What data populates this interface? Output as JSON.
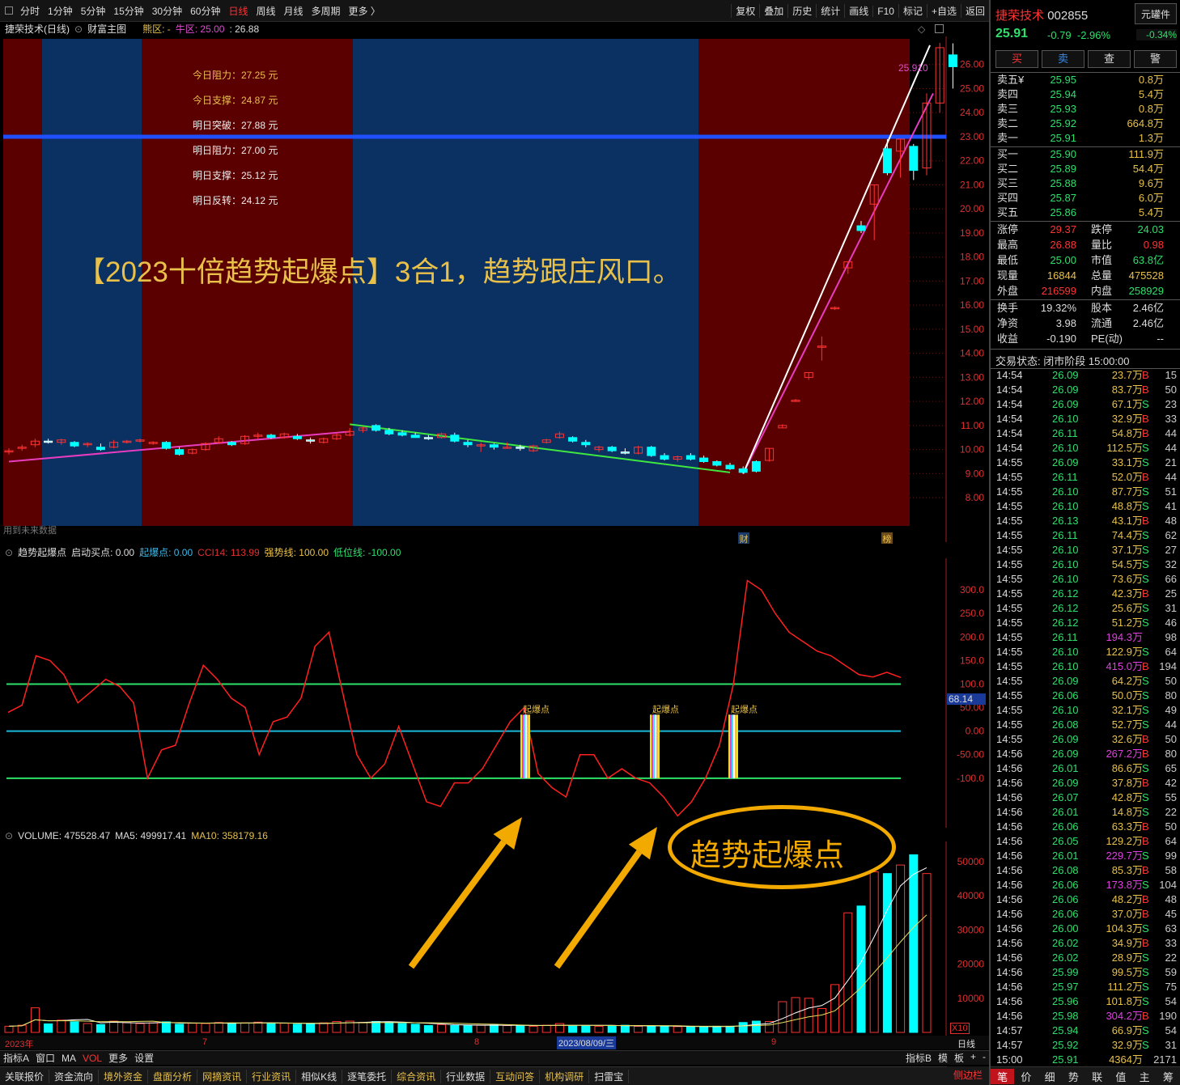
{
  "toolbar": {
    "periods": [
      "分时",
      "1分钟",
      "5分钟",
      "15分钟",
      "30分钟",
      "60分钟",
      "日线",
      "周线",
      "月线",
      "多周期",
      "更多 〉"
    ],
    "active": "日线",
    "right": [
      "复权",
      "叠加",
      "历史",
      "统计",
      "画线",
      "F10",
      "标记",
      "+自选",
      "返回"
    ]
  },
  "header": {
    "stock": "捷荣技术(日线)",
    "indicator": "财富主图",
    "can_label": "熊区: -",
    "bull_label": "牛区: 25.00",
    "value": ": 26.88"
  },
  "levels": [
    "今日阻力：27.25 元",
    "今日支撑：24.87 元",
    "明日突破：27.88 元",
    "明日阻力：27.00 元",
    "明日支撑：25.12 元",
    "明日反转：24.12 元"
  ],
  "headline": "【2023十倍趋势起爆点】3合1，趋势跟庄风口。",
  "future_note": "用到未来数据",
  "last_price_tag": "25.910",
  "markers": {
    "cai": "财",
    "bang": "榜"
  },
  "main_axis": [
    "26.00",
    "25.00",
    "24.00",
    "23.00",
    "22.00",
    "21.00",
    "20.00",
    "19.00",
    "18.00",
    "17.00",
    "16.00",
    "15.00",
    "14.00",
    "13.00",
    "12.00",
    "11.00",
    "10.00",
    "9.00",
    "8.00"
  ],
  "ind_header": {
    "name": "趋势起爆点",
    "start": "启动买点: 0.00",
    "qbd": "起爆点: 0.00",
    "cci": "CCI14: 113.99",
    "strong": "强势线: 100.00",
    "low": "低位线: -100.00"
  },
  "ind_axis": [
    "300.0",
    "250.0",
    "200.0",
    "150.0",
    "100.0",
    "50.00",
    "0.00",
    "-50.00",
    "-100.0"
  ],
  "ind_tag": "68.14",
  "qbd_label": "起爆点",
  "vol_header": {
    "vol": "VOLUME: 475528.47",
    "ma5": "MA5: 499917.41",
    "ma10": "MA10: 358179.16"
  },
  "vol_axis": [
    "50000",
    "40000",
    "30000",
    "20000",
    "10000"
  ],
  "vol_unit": "X10",
  "oval_text": "趋势起爆点",
  "date_axis": {
    "year": "2023年",
    "m7": "7",
    "m8": "8",
    "m9": "9",
    "cursor": "2023/08/09/三",
    "period": "日线"
  },
  "tabs1": [
    "指标A",
    "窗口",
    "MA",
    "VOL",
    "更多",
    "设置"
  ],
  "tabs1_active": "VOL",
  "tabs1_right": [
    "指标B",
    "模",
    "板",
    "+",
    "-"
  ],
  "tabs2": [
    "关联报价",
    "资金流向",
    "境外资金",
    "盘面分析",
    "网摘资讯",
    "行业资讯",
    "相似K线",
    "逐笔委托",
    "综合资讯",
    "行业数据",
    "互动问答",
    "机构调研",
    "扫雷宝"
  ],
  "tabs2_right": "侧边栏",
  "side": {
    "name": "捷荣技术",
    "code": "002855",
    "unit": "元罐件",
    "price": "25.91",
    "chg": "-0.79",
    "pct": "-2.96%",
    "pct_box": "-0.34%",
    "btns": [
      "买",
      "卖",
      "查",
      "警"
    ],
    "asks": [
      [
        "卖五¥",
        "25.95",
        "0.8万"
      ],
      [
        "卖四",
        "25.94",
        "5.4万"
      ],
      [
        "卖三",
        "25.93",
        "0.8万"
      ],
      [
        "卖二",
        "25.92",
        "664.8万"
      ],
      [
        "卖一",
        "25.91",
        "1.3万"
      ]
    ],
    "bids": [
      [
        "买一",
        "25.90",
        "111.9万"
      ],
      [
        "买二",
        "25.89",
        "54.4万"
      ],
      [
        "买三",
        "25.88",
        "9.6万"
      ],
      [
        "买四",
        "25.87",
        "6.0万"
      ],
      [
        "买五",
        "25.86",
        "5.4万"
      ]
    ],
    "stats": [
      [
        "涨停",
        "29.37",
        "跌停",
        "24.03"
      ],
      [
        "最高",
        "26.88",
        "量比",
        "0.98"
      ],
      [
        "最低",
        "25.00",
        "市值",
        "63.8亿"
      ],
      [
        "现量",
        "16844",
        "总量",
        "475528"
      ],
      [
        "外盘",
        "216599",
        "内盘",
        "258929"
      ]
    ],
    "stats2": [
      [
        "换手",
        "19.32%",
        "股本",
        "2.46亿"
      ],
      [
        "净资",
        "3.98",
        "流通",
        "2.46亿"
      ],
      [
        "收益",
        "-0.190",
        "PE(动)",
        "--"
      ]
    ],
    "status": "交易状态: 闭市阶段 15:00:00",
    "ticks": [
      [
        "14:54",
        "26.09",
        "23.7万",
        "B",
        "15"
      ],
      [
        "14:54",
        "26.09",
        "83.7万",
        "B",
        "50"
      ],
      [
        "14:54",
        "26.09",
        "67.1万",
        "S",
        "23"
      ],
      [
        "14:54",
        "26.10",
        "32.9万",
        "B",
        "33"
      ],
      [
        "14:54",
        "26.11",
        "54.8万",
        "B",
        "44"
      ],
      [
        "14:54",
        "26.10",
        "112.5万",
        "S",
        "44"
      ],
      [
        "14:55",
        "26.09",
        "33.1万",
        "S",
        "21"
      ],
      [
        "14:55",
        "26.11",
        "52.0万",
        "B",
        "44"
      ],
      [
        "14:55",
        "26.10",
        "87.7万",
        "S",
        "51"
      ],
      [
        "14:55",
        "26.10",
        "48.8万",
        "S",
        "41"
      ],
      [
        "14:55",
        "26.13",
        "43.1万",
        "B",
        "48"
      ],
      [
        "14:55",
        "26.11",
        "74.4万",
        "S",
        "62"
      ],
      [
        "14:55",
        "26.10",
        "37.1万",
        "S",
        "27"
      ],
      [
        "14:55",
        "26.10",
        "54.5万",
        "S",
        "32"
      ],
      [
        "14:55",
        "26.10",
        "73.6万",
        "S",
        "66"
      ],
      [
        "14:55",
        "26.12",
        "42.3万",
        "B",
        "25"
      ],
      [
        "14:55",
        "26.12",
        "25.6万",
        "S",
        "31"
      ],
      [
        "14:55",
        "26.12",
        "51.2万",
        "S",
        "46"
      ],
      [
        "14:55",
        "26.11",
        "194.3万",
        "",
        "98"
      ],
      [
        "14:55",
        "26.10",
        "122.9万",
        "S",
        "64"
      ],
      [
        "14:55",
        "26.10",
        "415.0万",
        "B",
        "194"
      ],
      [
        "14:55",
        "26.09",
        "64.2万",
        "S",
        "50"
      ],
      [
        "14:55",
        "26.06",
        "50.0万",
        "S",
        "80"
      ],
      [
        "14:55",
        "26.10",
        "32.1万",
        "S",
        "49"
      ],
      [
        "14:55",
        "26.08",
        "52.7万",
        "S",
        "44"
      ],
      [
        "14:55",
        "26.09",
        "32.6万",
        "B",
        "50"
      ],
      [
        "14:56",
        "26.09",
        "267.2万",
        "B",
        "80"
      ],
      [
        "14:56",
        "26.01",
        "86.6万",
        "S",
        "65"
      ],
      [
        "14:56",
        "26.09",
        "37.8万",
        "B",
        "42"
      ],
      [
        "14:56",
        "26.07",
        "42.8万",
        "S",
        "55"
      ],
      [
        "14:56",
        "26.01",
        "14.8万",
        "S",
        "22"
      ],
      [
        "14:56",
        "26.06",
        "63.3万",
        "B",
        "50"
      ],
      [
        "14:56",
        "26.05",
        "129.2万",
        "B",
        "64"
      ],
      [
        "14:56",
        "26.01",
        "229.7万",
        "S",
        "99"
      ],
      [
        "14:56",
        "26.08",
        "85.3万",
        "B",
        "58"
      ],
      [
        "14:56",
        "26.06",
        "173.8万",
        "S",
        "104"
      ],
      [
        "14:56",
        "26.06",
        "48.2万",
        "B",
        "48"
      ],
      [
        "14:56",
        "26.06",
        "37.0万",
        "B",
        "45"
      ],
      [
        "14:56",
        "26.00",
        "104.3万",
        "S",
        "63"
      ],
      [
        "14:56",
        "26.02",
        "34.9万",
        "B",
        "33"
      ],
      [
        "14:56",
        "26.02",
        "28.9万",
        "S",
        "22"
      ],
      [
        "14:56",
        "25.99",
        "99.5万",
        "S",
        "59"
      ],
      [
        "14:56",
        "25.97",
        "111.2万",
        "S",
        "75"
      ],
      [
        "14:56",
        "25.96",
        "101.8万",
        "S",
        "54"
      ],
      [
        "14:56",
        "25.98",
        "304.2万",
        "B",
        "190"
      ],
      [
        "14:57",
        "25.94",
        "66.9万",
        "S",
        "54"
      ],
      [
        "14:57",
        "25.92",
        "32.9万",
        "S",
        "31"
      ],
      [
        "15:00",
        "25.91",
        "4364万",
        "",
        "2171"
      ]
    ],
    "bottom": [
      "笔",
      "价",
      "细",
      "势",
      "联",
      "值",
      "主",
      "筹"
    ],
    "bottom_active": "笔",
    "side_tab": "侧边栏"
  },
  "chart_data": {
    "type": "candlestick",
    "ohlc": [
      [
        9.9,
        10.05,
        9.8,
        9.95
      ],
      [
        10.05,
        10.2,
        9.95,
        10.1
      ],
      [
        10.2,
        10.45,
        10.1,
        10.35
      ],
      [
        10.35,
        10.45,
        10.25,
        10.3
      ],
      [
        10.3,
        10.45,
        10.2,
        10.4
      ],
      [
        10.3,
        10.35,
        10.1,
        10.15
      ],
      [
        10.2,
        10.3,
        10.1,
        10.25
      ],
      [
        10.1,
        10.25,
        9.95,
        10.0
      ],
      [
        10.1,
        10.4,
        10.05,
        10.3
      ],
      [
        10.3,
        10.4,
        10.25,
        10.35
      ],
      [
        10.35,
        10.45,
        10.3,
        10.4
      ],
      [
        10.3,
        10.35,
        10.2,
        10.3
      ],
      [
        10.3,
        10.35,
        10.0,
        10.05
      ],
      [
        10.0,
        10.1,
        9.75,
        9.8
      ],
      [
        9.85,
        10.05,
        9.8,
        10.0
      ],
      [
        10.0,
        10.3,
        9.95,
        10.25
      ],
      [
        10.3,
        10.55,
        10.25,
        10.45
      ],
      [
        10.3,
        10.35,
        10.15,
        10.2
      ],
      [
        10.25,
        10.6,
        10.2,
        10.55
      ],
      [
        10.55,
        10.7,
        10.45,
        10.6
      ],
      [
        10.6,
        10.65,
        10.45,
        10.5
      ],
      [
        10.5,
        10.7,
        10.45,
        10.65
      ],
      [
        10.55,
        10.65,
        10.4,
        10.45
      ],
      [
        10.4,
        10.5,
        10.25,
        10.35
      ],
      [
        10.3,
        10.5,
        10.25,
        10.45
      ],
      [
        10.45,
        10.7,
        10.4,
        10.6
      ],
      [
        10.6,
        10.9,
        10.55,
        10.75
      ],
      [
        10.8,
        10.95,
        10.7,
        10.9
      ],
      [
        11.0,
        11.05,
        10.75,
        10.8
      ],
      [
        10.8,
        10.9,
        10.6,
        10.65
      ],
      [
        10.7,
        10.8,
        10.55,
        10.6
      ],
      [
        10.6,
        10.7,
        10.5,
        10.5
      ],
      [
        10.5,
        10.6,
        10.4,
        10.45
      ],
      [
        10.5,
        10.7,
        10.45,
        10.65
      ],
      [
        10.6,
        10.7,
        10.3,
        10.35
      ],
      [
        10.3,
        10.4,
        10.1,
        10.2
      ],
      [
        10.2,
        10.3,
        9.9,
        10.2
      ],
      [
        10.2,
        10.25,
        10.0,
        10.1
      ],
      [
        10.1,
        10.3,
        10.05,
        10.1
      ],
      [
        10.1,
        10.2,
        9.95,
        10.05
      ],
      [
        9.95,
        10.2,
        9.9,
        10.15
      ],
      [
        10.3,
        10.45,
        10.25,
        10.4
      ],
      [
        10.5,
        10.75,
        10.45,
        10.65
      ],
      [
        10.5,
        10.55,
        10.3,
        10.35
      ],
      [
        10.3,
        10.4,
        10.1,
        10.2
      ],
      [
        10.0,
        10.15,
        9.9,
        10.1
      ],
      [
        10.1,
        10.15,
        9.9,
        9.95
      ],
      [
        9.9,
        10.05,
        9.8,
        9.85
      ],
      [
        9.85,
        10.15,
        9.8,
        10.1
      ],
      [
        10.1,
        10.15,
        9.7,
        9.75
      ],
      [
        9.75,
        9.85,
        9.55,
        9.6
      ],
      [
        9.6,
        9.75,
        9.5,
        9.7
      ],
      [
        9.75,
        9.85,
        9.55,
        9.6
      ],
      [
        9.65,
        9.75,
        9.45,
        9.5
      ],
      [
        9.5,
        9.55,
        9.3,
        9.35
      ],
      [
        9.35,
        9.45,
        9.15,
        9.2
      ],
      [
        9.2,
        9.3,
        9.0,
        9.05
      ],
      [
        9.5,
        9.55,
        9.05,
        9.1
      ],
      [
        9.55,
        10.05,
        9.5,
        10.05
      ],
      [
        10.9,
        11.05,
        10.9,
        11.0
      ],
      [
        12.05,
        12.1,
        12.0,
        12.05
      ],
      [
        13.0,
        13.2,
        12.9,
        13.2
      ],
      [
        14.3,
        14.7,
        13.7,
        14.3
      ],
      [
        15.9,
        15.95,
        15.8,
        15.9
      ],
      [
        17.55,
        17.8,
        17.3,
        17.8
      ],
      [
        19.3,
        19.5,
        19.0,
        19.1
      ],
      [
        20.2,
        21.0,
        18.7,
        21.0
      ],
      [
        22.5,
        22.9,
        21.4,
        21.5
      ],
      [
        22.4,
        22.9,
        21.3,
        22.9
      ],
      [
        22.6,
        22.7,
        21.2,
        21.6
      ],
      [
        21.7,
        24.8,
        21.4,
        24.4
      ],
      [
        24.4,
        26.9,
        24.0,
        26.7
      ],
      [
        26.4,
        26.88,
        25.0,
        25.91
      ]
    ],
    "y_range": [
      7.5,
      27
    ],
    "cci": [
      40,
      55,
      160,
      150,
      120,
      60,
      85,
      110,
      95,
      60,
      -100,
      -40,
      -30,
      60,
      140,
      110,
      70,
      50,
      -50,
      20,
      30,
      70,
      180,
      210,
      80,
      -50,
      -100,
      -70,
      10,
      -70,
      -150,
      -160,
      -110,
      -110,
      -80,
      -30,
      20,
      50,
      -90,
      -120,
      -140,
      -50,
      -50,
      -100,
      -80,
      -100,
      -110,
      -140,
      -180,
      -150,
      -100,
      -30,
      100,
      320,
      300,
      250,
      210,
      190,
      170,
      160,
      140,
      120,
      115,
      125,
      114
    ],
    "cci_range": [
      -200,
      350
    ],
    "volume": [
      18000,
      21000,
      72000,
      25000,
      36000,
      31000,
      26000,
      23000,
      33000,
      29000,
      26000,
      28000,
      31000,
      24000,
      27000,
      26000,
      29000,
      27000,
      28000,
      30000,
      26000,
      27000,
      24000,
      25000,
      28000,
      32000,
      33000,
      29000,
      32000,
      31000,
      26000,
      24000,
      20000,
      23000,
      20000,
      21000,
      21000,
      22000,
      20000,
      19000,
      18000,
      21000,
      26000,
      20000,
      19000,
      18000,
      20000,
      21000,
      18000,
      19000,
      17000,
      17000,
      16000,
      17000,
      18000,
      18000,
      29000,
      33000,
      32000,
      90000,
      102000,
      100000,
      70000,
      140000,
      350000,
      370000,
      470000,
      465000,
      490000,
      520000,
      465000
    ],
    "vol_range": [
      0,
      540000
    ]
  }
}
